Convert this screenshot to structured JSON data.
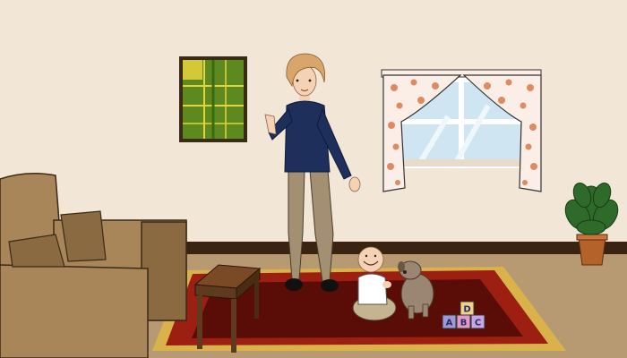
{
  "scene": {
    "colors": {
      "wall": "#f2e6d6",
      "floor": "#b89a72",
      "baseboard": "#3a2411",
      "rug_border": "#9c1f12",
      "rug_inner": "#5a0c07",
      "rug_fringe": "#d9b24a",
      "sofa": "#a8865a",
      "sofa_shade": "#8a6a40",
      "table": "#5e3a1f",
      "painting_frame": "#3b2a16",
      "painting_fill": "#5c8a1e",
      "painting_line": "#e8d23a",
      "curtain": "#fbeee6",
      "curtain_flower": "#e08a64",
      "window_glass": "#cfe6f2",
      "sweater": "#1e2f5c",
      "pants": "#a39072",
      "hair": "#d8a66a",
      "skin": "#f5d2b4",
      "plant_leaf": "#2e6b2a",
      "pot": "#b5622a",
      "dog": "#9a8672"
    },
    "blocks": {
      "letters": [
        "A",
        "B",
        "C",
        "D"
      ],
      "colors": [
        "#9c9bd8",
        "#e59ac6",
        "#c6a6e4",
        "#ecd389"
      ]
    }
  }
}
